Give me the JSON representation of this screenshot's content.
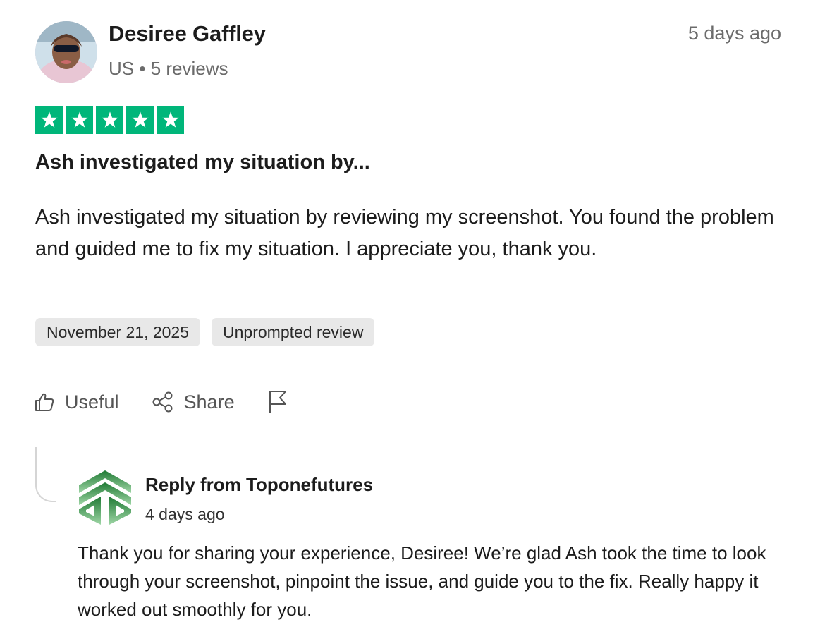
{
  "reviewer": {
    "name": "Desiree Gaffley",
    "country": "US",
    "separator": "•",
    "reviews_count": "5 reviews",
    "time_ago": "5 days ago"
  },
  "rating": {
    "value": 5,
    "max": 5,
    "color": "#00b67a"
  },
  "review": {
    "title": "Ash investigated my situation by...",
    "body": "Ash investigated my situation by reviewing my screenshot. You found the problem and guided me to fix my situation. I appreciate you, thank you.",
    "date_tag": "November 21, 2025",
    "type_tag": "Unprompted review"
  },
  "actions": {
    "useful_label": "Useful",
    "share_label": "Share",
    "useful_icon": "thumbs-up-icon",
    "share_icon": "share-icon",
    "flag_icon": "flag-icon"
  },
  "reply": {
    "from": "Reply from Toponefutures",
    "time_ago": "4 days ago",
    "body": "Thank you for sharing your experience, Desiree! We’re glad Ash took the time to look through your screenshot, pinpoint the issue, and guide you to the fix. Really happy it worked out smoothly for you.",
    "logo_color": "#2e8b3c"
  }
}
